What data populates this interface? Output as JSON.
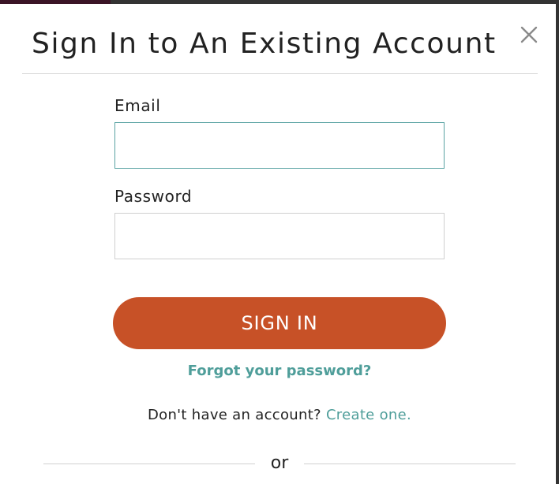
{
  "modal": {
    "title": "Sign In to An Existing Account",
    "close_icon": "close-icon"
  },
  "form": {
    "email_label": "Email",
    "email_value": "",
    "password_label": "Password",
    "password_value": "",
    "sign_in_label": "SIGN IN",
    "forgot_password_label": "Forgot your password?"
  },
  "signup": {
    "prompt": "Don't have an account?",
    "link_label": "Create one."
  },
  "separator": {
    "label": "or"
  },
  "colors": {
    "accent_button": "#c75127",
    "link": "#4f9e9a",
    "focus_border": "#5aa3a3"
  }
}
